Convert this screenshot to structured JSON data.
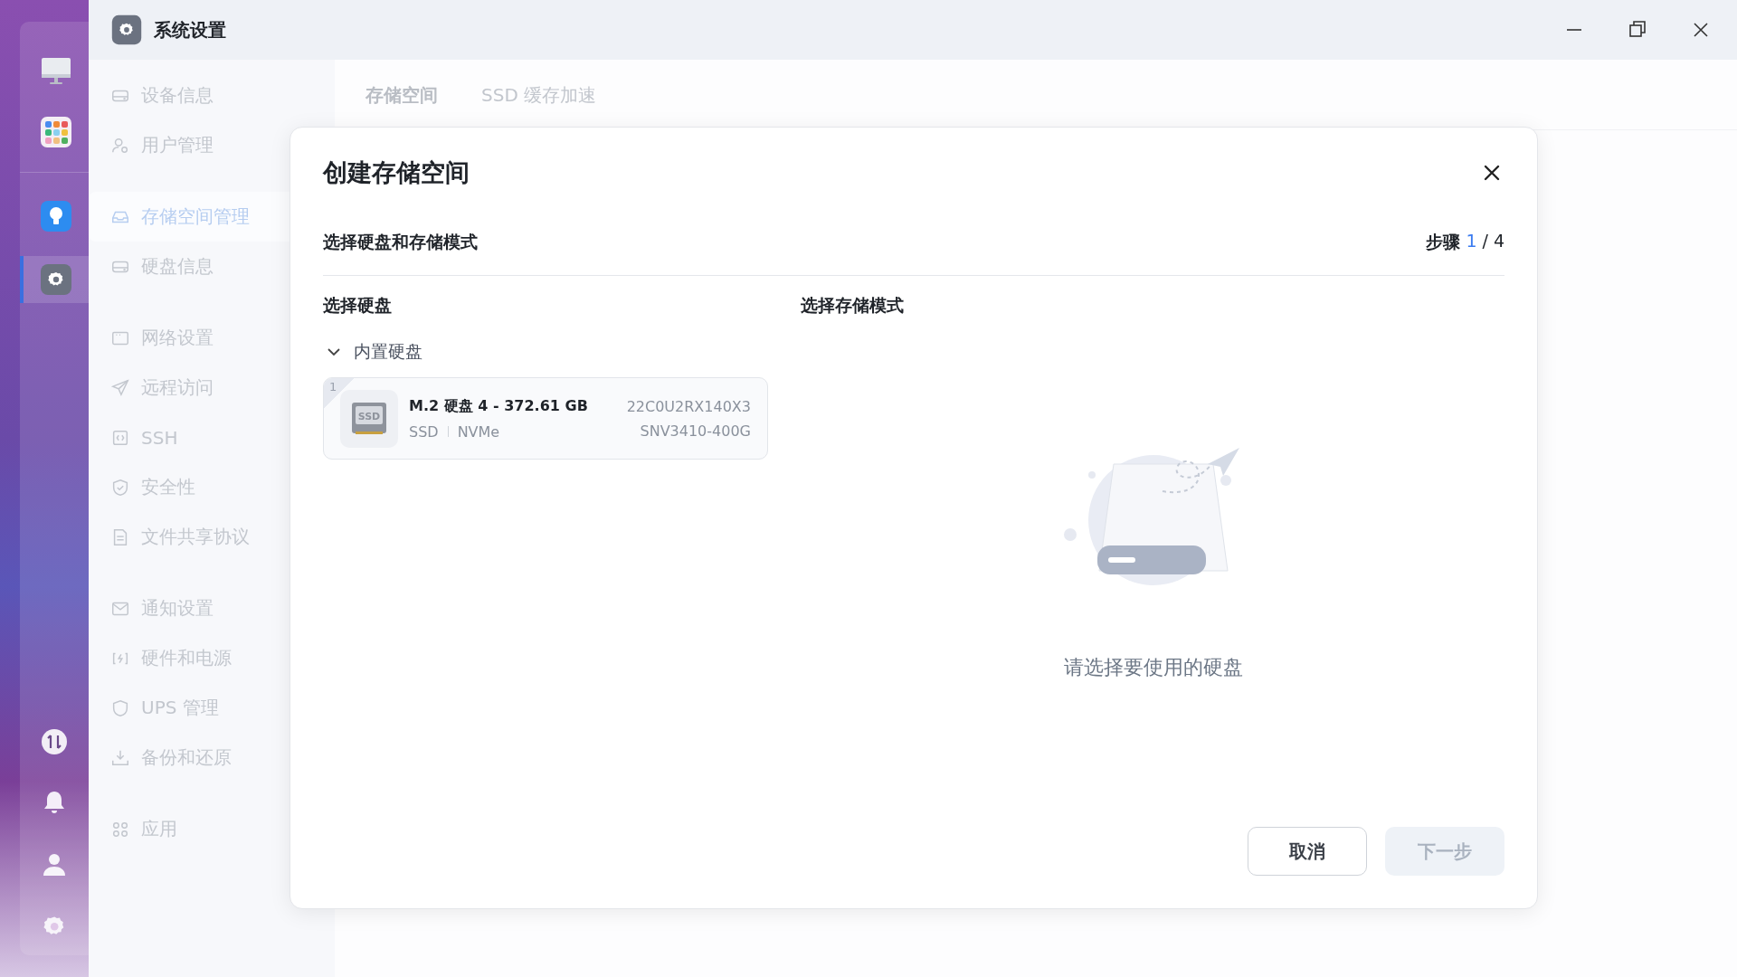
{
  "window": {
    "title": "系统设置"
  },
  "dock": {
    "top": [
      {
        "kind": "monitor",
        "selected": false
      },
      {
        "kind": "apps",
        "selected": false
      }
    ],
    "middle": [
      {
        "kind": "bulb",
        "selected": false
      },
      {
        "kind": "settings",
        "selected": true
      }
    ],
    "bottom": [
      {
        "kind": "transfer"
      },
      {
        "kind": "bell"
      },
      {
        "kind": "user"
      },
      {
        "kind": "gear"
      }
    ]
  },
  "sidebar": {
    "groups": [
      [
        {
          "label": "设备信息",
          "kind": "drive",
          "selected": false
        },
        {
          "label": "用户管理",
          "kind": "user",
          "selected": false
        }
      ],
      [
        {
          "label": "存储空间管理",
          "kind": "inbox",
          "selected": true
        },
        {
          "label": "硬盘信息",
          "kind": "drive",
          "selected": false
        }
      ],
      [
        {
          "label": "网络设置",
          "kind": "window",
          "selected": false
        },
        {
          "label": "远程访问",
          "kind": "send",
          "selected": false
        },
        {
          "label": "SSH",
          "kind": "code",
          "selected": false
        },
        {
          "label": "安全性",
          "kind": "shieldcheck",
          "selected": false
        },
        {
          "label": "文件共享协议",
          "kind": "file",
          "selected": false
        }
      ],
      [
        {
          "label": "通知设置",
          "kind": "mail",
          "selected": false
        },
        {
          "label": "硬件和电源",
          "kind": "power",
          "selected": false
        },
        {
          "label": "UPS 管理",
          "kind": "shield",
          "selected": false
        },
        {
          "label": "备份和还原",
          "kind": "download",
          "selected": false
        }
      ],
      [
        {
          "label": "应用",
          "kind": "grid",
          "selected": false
        }
      ]
    ]
  },
  "tabs": [
    {
      "label": "存储空间",
      "selected": true
    },
    {
      "label": "SSD 缓存加速",
      "selected": false
    }
  ],
  "dialog": {
    "title": "创建存储空间",
    "subtitle": "选择硬盘和存储模式",
    "step": {
      "label": "步骤",
      "current": "1",
      "rest": "/ 4"
    },
    "disks_heading": "选择硬盘",
    "mode_heading": "选择存储模式",
    "disk_groups": [
      {
        "label": "内置硬盘",
        "expanded": true,
        "disks": [
          {
            "number": "1",
            "icon_label": "SSD",
            "name": "M.2 硬盘 4 - 372.61 GB",
            "type": "SSD",
            "interface": "NVMe",
            "serial": "22C0U2RX140X3",
            "model": "SNV3410-400G",
            "selected": false
          }
        ]
      }
    ],
    "empty_message": "请选择要使用的硬盘",
    "buttons": [
      {
        "label": "取消",
        "kind": "secondary",
        "disabled": false
      },
      {
        "label": "下一步",
        "kind": "primary",
        "disabled": true
      }
    ]
  }
}
